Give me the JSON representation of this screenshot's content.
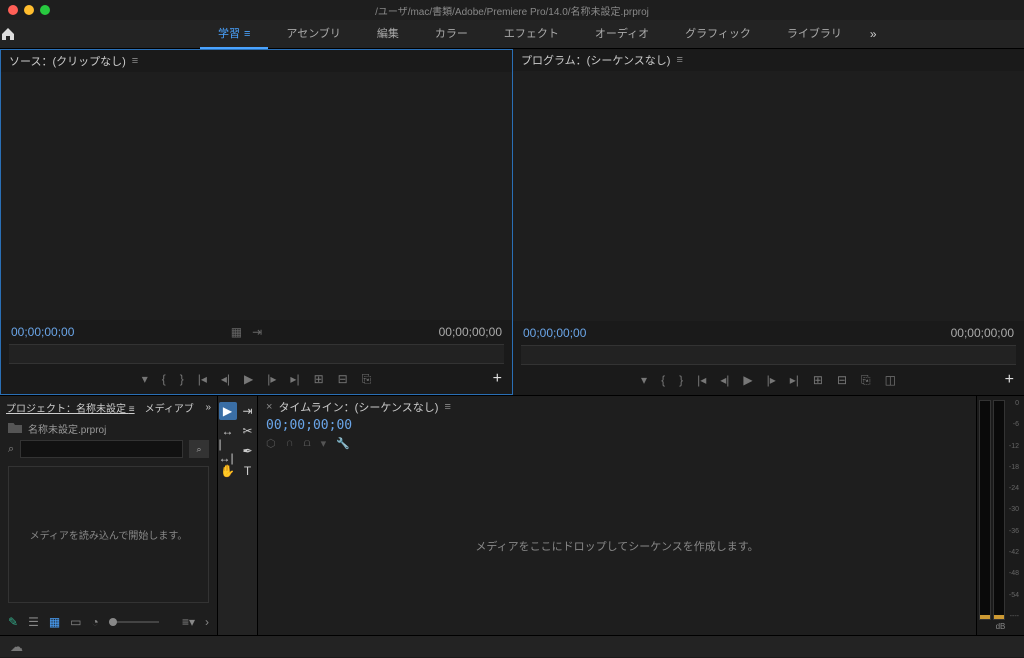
{
  "title": "/ユーザ/mac/書類/Adobe/Premiere Pro/14.0/名称未設定.prproj",
  "workspaces": {
    "items": [
      "学習",
      "アセンブリ",
      "編集",
      "カラー",
      "エフェクト",
      "オーディオ",
      "グラフィック",
      "ライブラリ"
    ],
    "active": 0,
    "more": "»"
  },
  "source": {
    "title": "ソース：(クリップなし)",
    "tc_left": "00;00;00;00",
    "tc_right": "00;00;00;00",
    "plus": "+"
  },
  "program": {
    "title": "プログラム：(シーケンスなし)",
    "tc_left": "00;00;00;00",
    "tc_right": "00;00;00;00",
    "plus": "+"
  },
  "project": {
    "tab_project": "プロジェクト：名称未設定",
    "tab_media": "メディアブ",
    "more": "»",
    "filename": "名称未設定.prproj",
    "search_placeholder": "",
    "search_glyph": "⌕",
    "empty_msg": "メディアを読み込んで開始します。"
  },
  "timeline": {
    "title": "タイムライン：(シーケンスなし)",
    "tc": "00;00;00;00",
    "empty_msg": "メディアをここにドロップしてシーケンスを作成します。"
  },
  "audio": {
    "ticks": [
      "0",
      "-6",
      "-12",
      "-18",
      "-24",
      "-30",
      "-36",
      "-42",
      "-48",
      "-54",
      "----"
    ],
    "label": "dB"
  },
  "burger": "≡"
}
